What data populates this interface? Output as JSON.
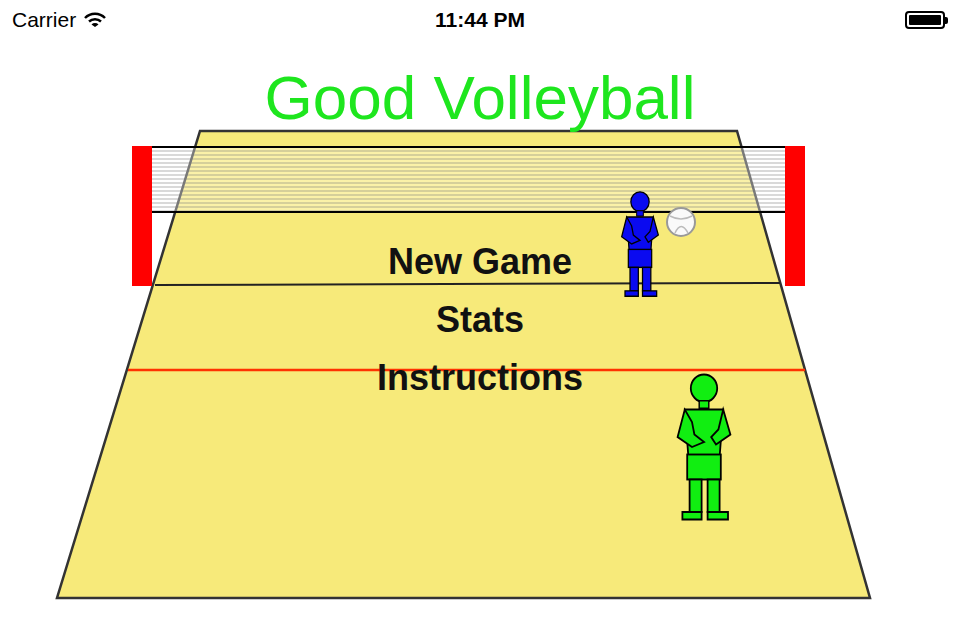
{
  "status_bar": {
    "carrier": "Carrier",
    "time": "11:44 PM",
    "battery_level": 1.0
  },
  "title": "Good Volleyball",
  "menu": [
    {
      "label": "New Game"
    },
    {
      "label": "Stats"
    },
    {
      "label": "Instructions"
    }
  ],
  "players": [
    {
      "team": "far",
      "color": "#0a0af0"
    },
    {
      "team": "near",
      "color": "#11ee11"
    }
  ]
}
